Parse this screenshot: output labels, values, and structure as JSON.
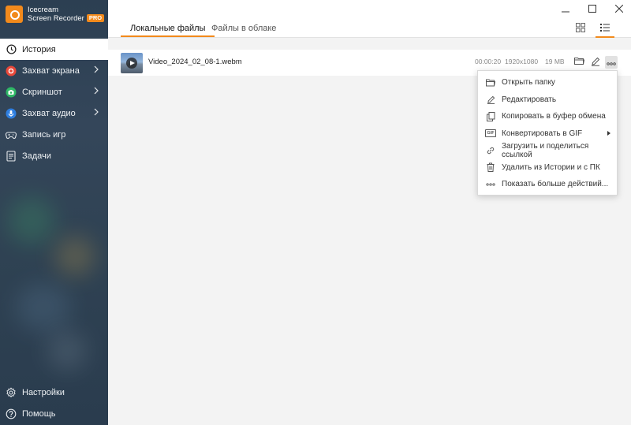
{
  "app": {
    "name_line1": "Icecream",
    "name_line2": "Screen Recorder",
    "badge": "PRO",
    "accent_color": "#f28a1c"
  },
  "sidebar": {
    "items": [
      {
        "label": "История",
        "icon": "clock-icon",
        "active": true
      },
      {
        "label": "Захват экрана",
        "icon": "record-icon",
        "has_submenu": true
      },
      {
        "label": "Скриншот",
        "icon": "camera-icon",
        "has_submenu": true
      },
      {
        "label": "Захват аудио",
        "icon": "microphone-icon",
        "has_submenu": true
      },
      {
        "label": "Запись игр",
        "icon": "gamepad-icon"
      },
      {
        "label": "Задачи",
        "icon": "tasks-icon"
      }
    ],
    "bottom_items": [
      {
        "label": "Настройки",
        "icon": "gear-icon"
      },
      {
        "label": "Помощь",
        "icon": "help-icon"
      }
    ]
  },
  "tabs": [
    {
      "label": "Локальные файлы",
      "active": true
    },
    {
      "label": "Файлы в облаке",
      "active": false
    }
  ],
  "view_modes": [
    "grid-view-icon",
    "list-view-icon"
  ],
  "files": [
    {
      "name": "Video_2024_02_08-1.webm",
      "duration": "00:00:20",
      "resolution": "1920x1080",
      "size": "19 MB"
    }
  ],
  "context_menu": {
    "items": [
      {
        "label": "Открыть папку",
        "icon": "folder-icon"
      },
      {
        "label": "Редактировать",
        "icon": "pencil-icon"
      },
      {
        "label": "Копировать в буфер обмена",
        "icon": "copy-icon"
      },
      {
        "label": "Конвертировать в GIF",
        "icon": "gif-icon",
        "icon_text": "GIF",
        "has_submenu": true
      },
      {
        "label": "Загрузить и поделиться ссылкой",
        "icon": "link-icon"
      },
      {
        "label": "Удалить из Истории и с ПК",
        "icon": "trash-icon"
      },
      {
        "label": "Показать больше действий...",
        "icon": "more-icon"
      }
    ]
  }
}
